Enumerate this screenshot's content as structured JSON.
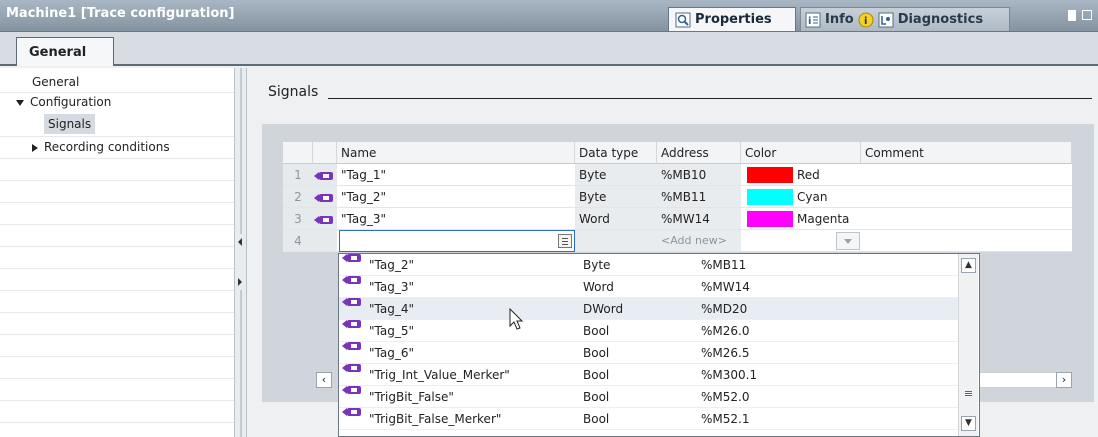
{
  "window": {
    "title": "Machine1 [Trace configuration]"
  },
  "inspector_tabs": [
    {
      "label": "Properties",
      "active": true,
      "icon": "properties-icon"
    },
    {
      "label": "Info",
      "active": false,
      "icon": "info-icon"
    },
    {
      "label": "Diagnostics",
      "active": false,
      "icon": "diagnostics-icon"
    }
  ],
  "general_tab": {
    "label": "General"
  },
  "nav": {
    "items": [
      {
        "label": "General",
        "level": 0
      },
      {
        "label": "Configuration",
        "level": 0,
        "expanded": true
      },
      {
        "label": "Signals",
        "level": 1,
        "selected": true
      },
      {
        "label": "Recording conditions",
        "level": 1,
        "collapsed": true
      }
    ]
  },
  "signals": {
    "section_label": "Signals",
    "columns": [
      "Name",
      "Data type",
      "Address",
      "Color",
      "Comment"
    ],
    "rows": [
      {
        "num": "1",
        "name": "\"Tag_1\"",
        "type": "Byte",
        "address": "%MB10",
        "color_name": "Red",
        "color": "#ff0000"
      },
      {
        "num": "2",
        "name": "\"Tag_2\"",
        "type": "Byte",
        "address": "%MB11",
        "color_name": "Cyan",
        "color": "#00ffff"
      },
      {
        "num": "3",
        "name": "\"Tag_3\"",
        "type": "Word",
        "address": "%MW14",
        "color_name": "Magenta",
        "color": "#ff00ff"
      }
    ],
    "new_row": {
      "num": "4",
      "name": "",
      "address_placeholder": "<Add new>"
    }
  },
  "dropdown": {
    "items": [
      {
        "name": "\"Tag_2\"",
        "type": "Byte",
        "address": "%MB11"
      },
      {
        "name": "\"Tag_3\"",
        "type": "Word",
        "address": "%MW14"
      },
      {
        "name": "\"Tag_4\"",
        "type": "DWord",
        "address": "%MD20",
        "hovered": true
      },
      {
        "name": "\"Tag_5\"",
        "type": "Bool",
        "address": "%M26.0"
      },
      {
        "name": "\"Tag_6\"",
        "type": "Bool",
        "address": "%M26.5"
      },
      {
        "name": "\"Trig_Int_Value_Merker\"",
        "type": "Bool",
        "address": "%M300.1"
      },
      {
        "name": "\"TrigBit_False\"",
        "type": "Bool",
        "address": "%M52.0"
      },
      {
        "name": "\"TrigBit_False_Merker\"",
        "type": "Bool",
        "address": "%M52.1"
      }
    ]
  }
}
